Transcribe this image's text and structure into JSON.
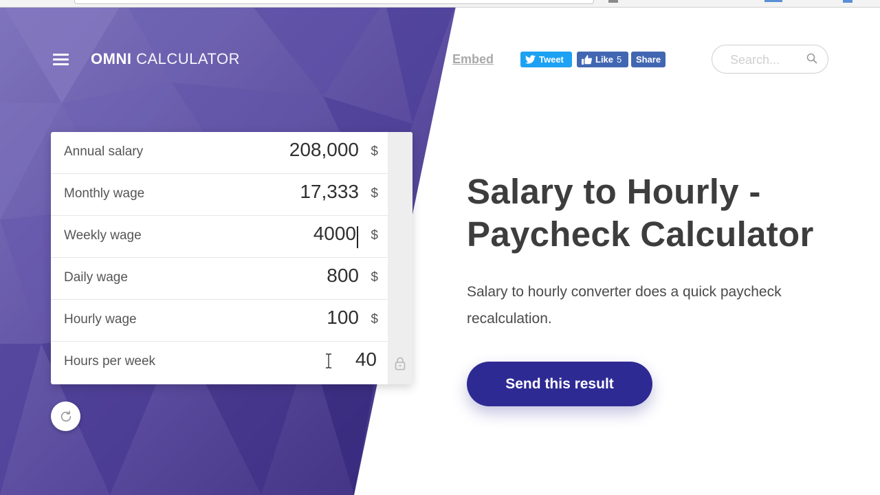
{
  "header": {
    "logo_strong": "OMNI",
    "logo_light": "CALCULATOR",
    "embed_label": "Embed",
    "tweet_label": "Tweet",
    "like_label": "Like",
    "like_count": "5",
    "share_label": "Share",
    "search_placeholder": "Search..."
  },
  "calculator": {
    "rows": [
      {
        "label": "Annual salary",
        "value": "208,000",
        "unit": "$"
      },
      {
        "label": "Monthly wage",
        "value": "17,333",
        "unit": "$"
      },
      {
        "label": "Weekly wage",
        "value": "4000",
        "unit": "$"
      },
      {
        "label": "Daily wage",
        "value": "800",
        "unit": "$"
      },
      {
        "label": "Hourly wage",
        "value": "100",
        "unit": "$"
      },
      {
        "label": "Hours per week",
        "value": "40",
        "unit": ""
      }
    ],
    "focused_row": "Weekly wage"
  },
  "main": {
    "title": "Salary to Hourly - Paycheck Calculator",
    "description": "Salary to hourly converter does a quick paycheck recalculation.",
    "send_button": "Send this result"
  },
  "colors": {
    "purple_dark": "#3f2f8a",
    "purple_light": "#7a6cb8",
    "send_button": "#2e2a94",
    "tweet": "#1da1f2",
    "facebook": "#4267b2"
  },
  "icons": {
    "menu": "hamburger-icon",
    "search": "search-icon",
    "reset": "refresh-icon",
    "lock": "lock-icon",
    "twitter": "twitter-bird-icon",
    "like": "thumbs-up-icon"
  }
}
